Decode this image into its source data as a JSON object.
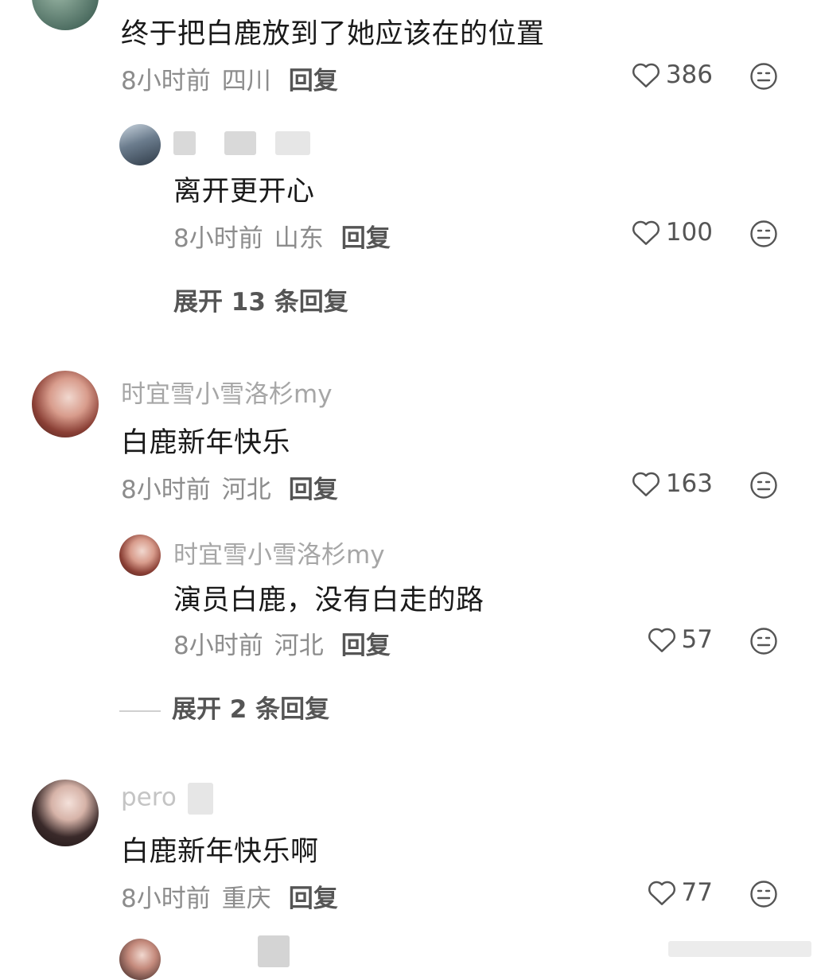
{
  "comments": [
    {
      "text": "终于把白鹿放到了她应该在的位置",
      "time": "8小时前",
      "location": "四川",
      "reply_label": "回复",
      "likes": "386",
      "replies": [
        {
          "username": "",
          "text": "离开更开心",
          "time": "8小时前",
          "location": "山东",
          "reply_label": "回复",
          "likes": "100"
        }
      ],
      "expand_label": "展开 13 条回复"
    },
    {
      "username": "时宜雪小雪洛杉my",
      "text": "白鹿新年快乐",
      "time": "8小时前",
      "location": "河北",
      "reply_label": "回复",
      "likes": "163",
      "replies": [
        {
          "username": "时宜雪小雪洛杉my",
          "text": "演员白鹿，没有白走的路",
          "time": "8小时前",
          "location": "河北",
          "reply_label": "回复",
          "likes": "57"
        }
      ],
      "expand_label": "展开 2 条回复"
    },
    {
      "username": "pero",
      "text": "白鹿新年快乐啊",
      "time": "8小时前",
      "location": "重庆",
      "reply_label": "回复",
      "likes": "77"
    }
  ],
  "icons": {
    "like": "heart-outline-icon",
    "dislike": "meh-face-icon"
  },
  "colors": {
    "text": "#1a1a1a",
    "meta": "#8c8c8c",
    "action": "#555555"
  }
}
